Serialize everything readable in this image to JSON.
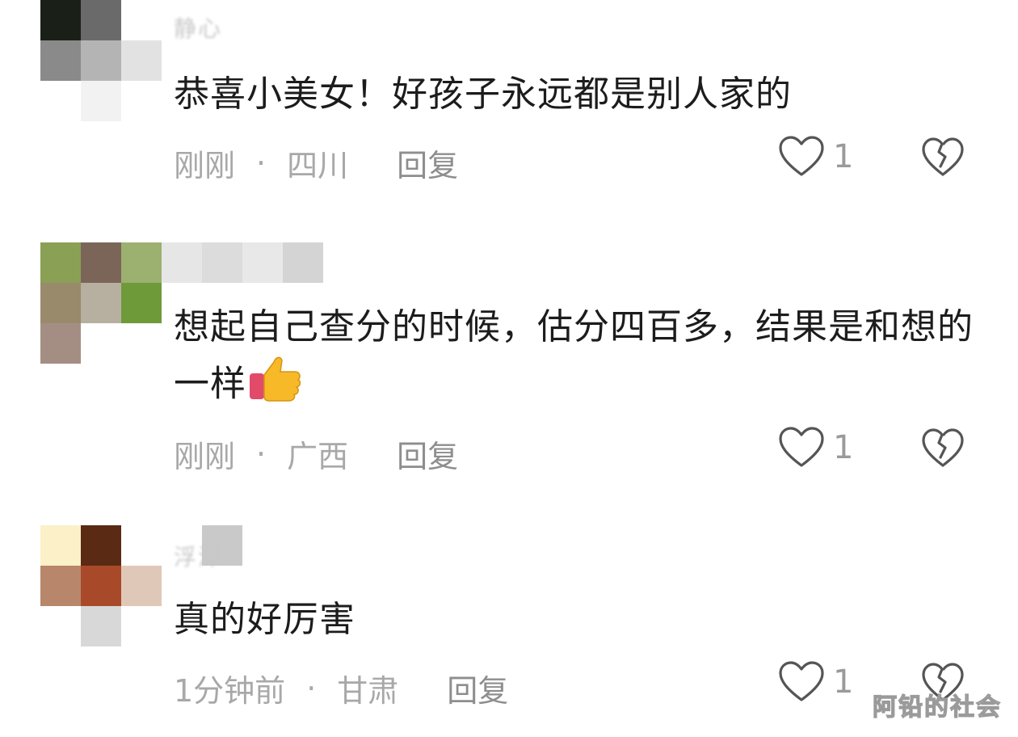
{
  "comments": [
    {
      "username": "静心",
      "text": "恭喜小美女！好孩子永远都是别人家的",
      "time": "刚刚",
      "location": "四川",
      "reply_label": "回复",
      "likes": "1"
    },
    {
      "username": "",
      "text": "想起自己查分的时候，估分四百多，结果是和想的一样",
      "emoji": "👍",
      "time": "刚刚",
      "location": "广西",
      "reply_label": "回复",
      "likes": "1"
    },
    {
      "username": "浮洋",
      "text": "真的好厉害",
      "time": "1分钟前",
      "location": "甘肃",
      "reply_label": "回复",
      "likes": "1"
    }
  ],
  "separator": "·",
  "watermark": "阿铅的社会"
}
